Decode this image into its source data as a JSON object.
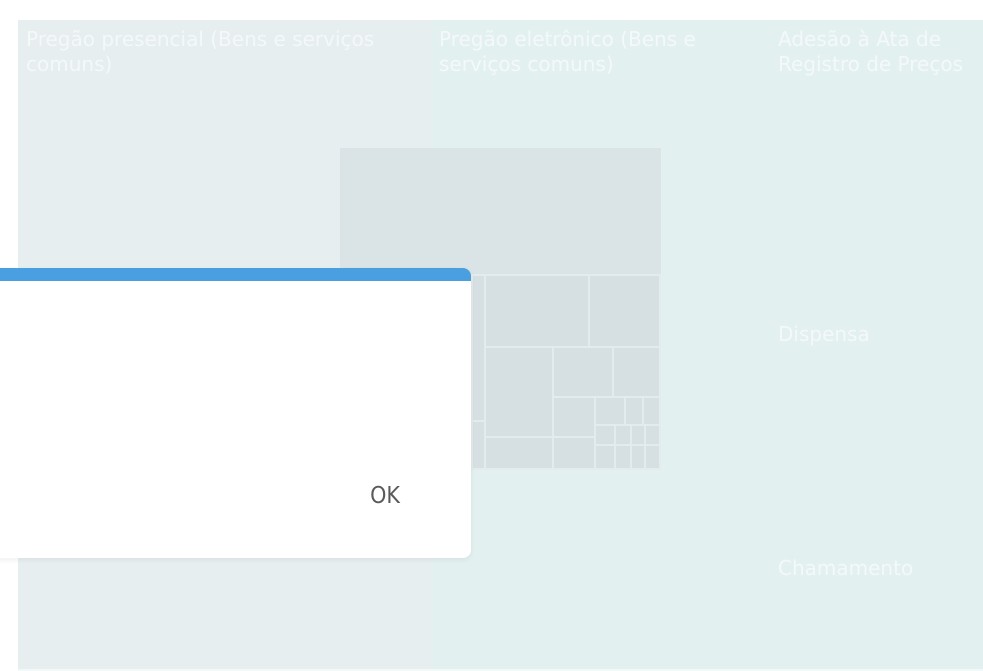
{
  "treemap": {
    "tiles": [
      {
        "label": "Pregão presencial (Bens e serviços comuns)"
      },
      {
        "label": "Pregão eletrônico (Bens e serviços comuns)"
      },
      {
        "label": "Adesão à Ata de Registro de Preços"
      },
      {
        "label": "Dispensa"
      },
      {
        "label": "Chamamento"
      }
    ]
  },
  "dialog": {
    "ok_label": "OK"
  },
  "colors": {
    "accent": "#4a9fe0",
    "tile_a": "#e6eef0",
    "tile_b": "#e3f0f0",
    "tile_text": "#f4f8f8"
  }
}
